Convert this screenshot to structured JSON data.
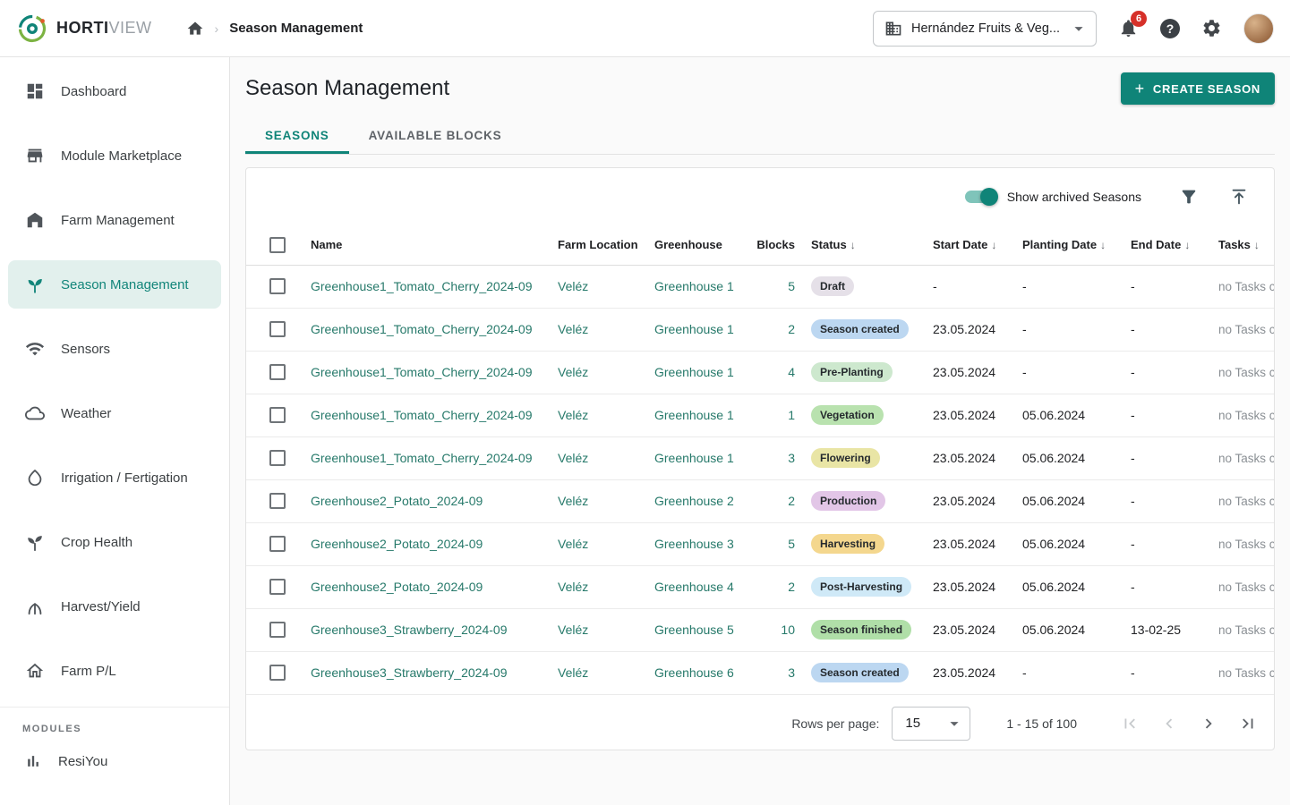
{
  "colors": {
    "accent": "#0f8478",
    "link": "#26796a",
    "notification_badge": "#d63029",
    "sidebar_active_bg": "#e2f0ed",
    "status": {
      "draft": "#e5e0e8",
      "season_created": "#bcd7f1",
      "pre_planting": "#cde8ce",
      "vegetation": "#b9e2af",
      "flowering": "#e9e5a5",
      "production": "#e2c6e7",
      "harvesting": "#f4d78e",
      "post_harvesting": "#cfe9f7",
      "season_finished": "#b0dfa8"
    }
  },
  "brand": {
    "bold": "HORTI",
    "light": "VIEW"
  },
  "header": {
    "breadcrumb": "Season Management",
    "company": "Hernández Fruits & Veg...",
    "notifications": "6",
    "help": "?"
  },
  "sidebar": {
    "items": [
      {
        "label": "Dashboard",
        "icon": "dashboard-icon"
      },
      {
        "label": "Module Marketplace",
        "icon": "marketplace-icon"
      },
      {
        "label": "Farm Management",
        "icon": "farm-icon"
      },
      {
        "label": "Season Management",
        "icon": "season-icon",
        "active": true
      },
      {
        "label": "Sensors",
        "icon": "sensors-icon"
      },
      {
        "label": "Weather",
        "icon": "weather-icon"
      },
      {
        "label": "Irrigation / Fertigation",
        "icon": "irrigation-icon"
      },
      {
        "label": "Crop Health",
        "icon": "crop-health-icon"
      },
      {
        "label": "Harvest/Yield",
        "icon": "harvest-icon"
      },
      {
        "label": "Farm P/L",
        "icon": "farm-pl-icon"
      }
    ],
    "modules_label": "MODULES",
    "module_items": [
      {
        "label": "ResiYou",
        "icon": "bar-chart-icon"
      }
    ]
  },
  "page": {
    "title": "Season Management",
    "create_button": "CREATE SEASON",
    "plus": "+",
    "tabs": {
      "seasons": "SEASONS",
      "blocks": "AVAILABLE BLOCKS"
    },
    "toggle_label": "Show archived Seasons"
  },
  "table": {
    "sort_arrow": "↓",
    "headers": {
      "name": "Name",
      "location": "Farm Location",
      "greenhouse": "Greenhouse",
      "blocks": "Blocks",
      "status": "Status",
      "start": "Start Date",
      "planting": "Planting Date",
      "end": "End Date",
      "tasks": "Tasks"
    },
    "rows": [
      {
        "name": "Greenhouse1_Tomato_Cherry_2024-09",
        "location": "Veléz",
        "greenhouse": "Greenhouse 1",
        "blocks": "5",
        "status": "Draft",
        "status_bg": "#e5e0e8",
        "start": "-",
        "planting": "-",
        "end": "-",
        "tasks": "no Tasks created"
      },
      {
        "name": "Greenhouse1_Tomato_Cherry_2024-09",
        "location": "Veléz",
        "greenhouse": "Greenhouse 1",
        "blocks": "2",
        "status": "Season created",
        "status_bg": "#bcd7f1",
        "start": "23.05.2024",
        "planting": "-",
        "end": "-",
        "tasks": "no Tasks created"
      },
      {
        "name": "Greenhouse1_Tomato_Cherry_2024-09",
        "location": "Veléz",
        "greenhouse": "Greenhouse 1",
        "blocks": "4",
        "status": "Pre-Planting",
        "status_bg": "#cde8ce",
        "start": "23.05.2024",
        "planting": "-",
        "end": "-",
        "tasks": "no Tasks created"
      },
      {
        "name": "Greenhouse1_Tomato_Cherry_2024-09",
        "location": "Veléz",
        "greenhouse": "Greenhouse 1",
        "blocks": "1",
        "status": "Vegetation",
        "status_bg": "#b9e2af",
        "start": "23.05.2024",
        "planting": "05.06.2024",
        "end": "-",
        "tasks": "no Tasks created"
      },
      {
        "name": "Greenhouse1_Tomato_Cherry_2024-09",
        "location": "Veléz",
        "greenhouse": "Greenhouse 1",
        "blocks": "3",
        "status": "Flowering",
        "status_bg": "#e9e5a5",
        "start": "23.05.2024",
        "planting": "05.06.2024",
        "end": "-",
        "tasks": "no Tasks created"
      },
      {
        "name": "Greenhouse2_Potato_2024-09",
        "location": "Veléz",
        "greenhouse": "Greenhouse 2",
        "blocks": "2",
        "status": "Production",
        "status_bg": "#e2c6e7",
        "start": "23.05.2024",
        "planting": "05.06.2024",
        "end": "-",
        "tasks": "no Tasks created"
      },
      {
        "name": "Greenhouse2_Potato_2024-09",
        "location": "Veléz",
        "greenhouse": "Greenhouse 3",
        "blocks": "5",
        "status": "Harvesting",
        "status_bg": "#f4d78e",
        "start": "23.05.2024",
        "planting": "05.06.2024",
        "end": "-",
        "tasks": "no Tasks created"
      },
      {
        "name": "Greenhouse2_Potato_2024-09",
        "location": "Veléz",
        "greenhouse": "Greenhouse 4",
        "blocks": "2",
        "status": "Post-Harvesting",
        "status_bg": "#cfe9f7",
        "start": "23.05.2024",
        "planting": "05.06.2024",
        "end": "-",
        "tasks": "no Tasks created"
      },
      {
        "name": "Greenhouse3_Strawberry_2024-09",
        "location": "Veléz",
        "greenhouse": "Greenhouse 5",
        "blocks": "10",
        "status": "Season finished",
        "status_bg": "#b0dfa8",
        "start": "23.05.2024",
        "planting": "05.06.2024",
        "end": "13-02-25",
        "tasks": "no Tasks created"
      },
      {
        "name": "Greenhouse3_Strawberry_2024-09",
        "location": "Veléz",
        "greenhouse": "Greenhouse 6",
        "blocks": "3",
        "status": "Season created",
        "status_bg": "#bcd7f1",
        "start": "23.05.2024",
        "planting": "-",
        "end": "-",
        "tasks": "no Tasks created"
      }
    ]
  },
  "pagination": {
    "rows_per_page_label": "Rows per page:",
    "rows_per_page": "15",
    "range": "1 - 15 of 100"
  }
}
